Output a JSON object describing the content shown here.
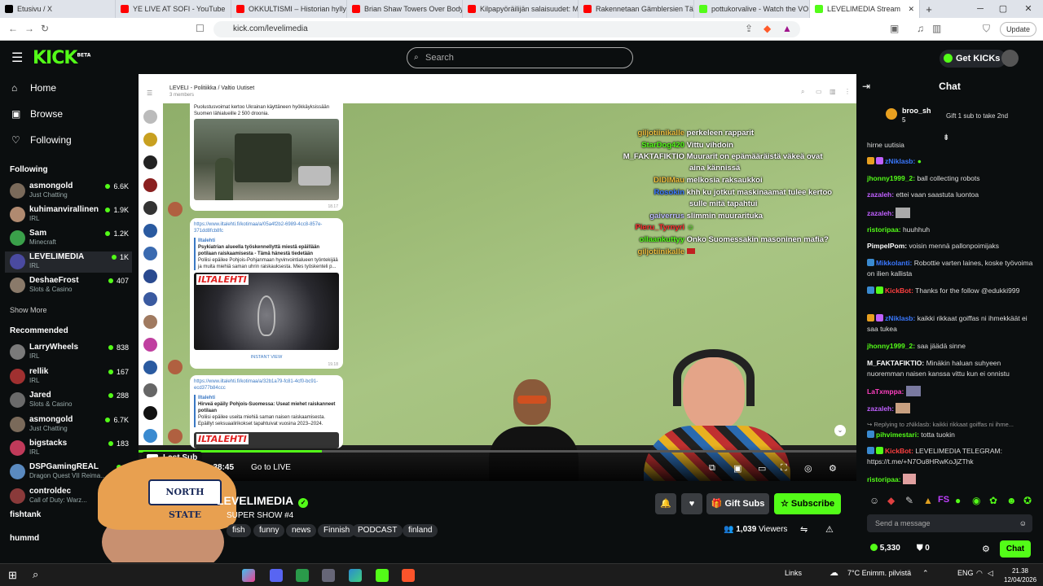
{
  "browser": {
    "tabs": [
      {
        "title": "Etusivu / X",
        "color": "#000000"
      },
      {
        "title": "YE LIVE AT SOFI - YouTube",
        "color": "#ff0000"
      },
      {
        "title": "OKKULTISMI – Historian hyllyt",
        "color": "#ff0000"
      },
      {
        "title": "Brian Shaw Towers Over Body",
        "color": "#ff0000"
      },
      {
        "title": "Kilpapyöräilijän salaisuudet: M",
        "color": "#ff0000"
      },
      {
        "title": "Rakennetaan Gämblersien Täy",
        "color": "#ff0000"
      },
      {
        "title": "pottukorvalive - Watch the VOD",
        "color": "#53fc18"
      },
      {
        "title": "LEVELIMEDIA Stream",
        "color": "#53fc18"
      }
    ],
    "url": "kick.com/levelimedia",
    "update_label": "Update"
  },
  "header": {
    "logo": "KICK",
    "logo_sup": "BETA",
    "search_placeholder": "Search",
    "get_kicks": "Get KICKs"
  },
  "sidebar": {
    "nav": [
      {
        "label": "Home",
        "icon": "home-icon"
      },
      {
        "label": "Browse",
        "icon": "browse-icon"
      },
      {
        "label": "Following",
        "icon": "heart-icon"
      }
    ],
    "following_title": "Following",
    "following": [
      {
        "name": "asmongold",
        "category": "Just Chatting",
        "viewers": "6.6K",
        "color": "#7a6a5a"
      },
      {
        "name": "kuhimanvirallinen",
        "category": "IRL",
        "viewers": "1.9K",
        "color": "#b08a70"
      },
      {
        "name": "Sam",
        "category": "Minecraft",
        "viewers": "1.2K",
        "color": "#3aa04a"
      },
      {
        "name": "LEVELIMEDIA",
        "category": "IRL",
        "viewers": "1K",
        "color": "#4a4aa0"
      },
      {
        "name": "DeshaeFrost",
        "category": "Slots & Casino",
        "viewers": "407",
        "color": "#8a7a6a"
      }
    ],
    "show_more": "Show More",
    "recommended_title": "Recommended",
    "recommended": [
      {
        "name": "LarryWheels",
        "category": "IRL",
        "viewers": "838",
        "color": "#7a7a7a"
      },
      {
        "name": "rellik",
        "category": "IRL",
        "viewers": "167",
        "color": "#a03030"
      },
      {
        "name": "Jared",
        "category": "Slots & Casino",
        "viewers": "288",
        "color": "#6a6a6a"
      },
      {
        "name": "asmongold",
        "category": "Just Chatting",
        "viewers": "6.7K",
        "color": "#7a6a5a"
      },
      {
        "name": "bigstacks",
        "category": "IRL",
        "viewers": "183",
        "color": "#c03a5a"
      },
      {
        "name": "DSPGamingREAL",
        "category": "Dragon Quest VII Reima...",
        "viewers": "7",
        "color": "#5a8ac0"
      },
      {
        "name": "controldec",
        "category": "Call of Duty: Warz...",
        "viewers": "",
        "color": "#8a3a3a"
      },
      {
        "name": "fishtank",
        "category": "",
        "viewers": "",
        "color": "#3a3a3a"
      },
      {
        "name": "hummd",
        "category": "",
        "viewers": "",
        "color": "#5a5a5a"
      }
    ]
  },
  "player": {
    "telegram_header": "LEVELI - Politiikka / Valtio Uutiset",
    "telegram_members": "3 members",
    "posts": [
      {
        "text": "Puolustusvoimat kertoo Ukrainan käyttäneen hyökkäyksissään Suomen lähialueille 2 500 droonia.",
        "time": "18.17"
      },
      {
        "link": "https://www.iltalehti.fi/kotimaa/a/05a4f2b2-6989-4cc8-857e-371dd8fcb8fc",
        "source": "Iltalehti",
        "headline": "Psykiatrian alueella työskennellyttä miestä epäillään potilaan raiskaamisesta - Tämä hänestä tiedetään",
        "body": "Poliisi epäilee Pohjois-Pohjanmaan hyvinvointialueen työntekijää ja muita miehiä saman uhrin raiskauksesta. Mies työskenteli p...",
        "image_label": "ILTALEHTI",
        "instant_view": "INSTANT VIEW",
        "time": "19.18"
      },
      {
        "link": "https://www.iltalehti.fi/kotimaa/a/32b1a79-fc81-4cf0-bc91-ecd377b84ccc",
        "source": "Iltalehti",
        "headline": "Hirveä epäily Pohjois-Suomessa: Useat miehet raiskanneet potilaan",
        "body": "Poliisi epäilee useita miehiä saman naisen raiskaamisesta. Epäillyt seksuaalirikokset tapahtuivat vuosina 2023–2024.",
        "image_label": "ILTALEHTI"
      }
    ],
    "overlay_chat": [
      {
        "user": "giljotiinikalle",
        "msg": "perkeleen rapparit",
        "color": "#f0c040"
      },
      {
        "user": "StarDog420",
        "msg": "Vittu vihdoin",
        "color": "#53fc18"
      },
      {
        "user": "M_FAKTAFIKTIO",
        "msg": "Muurarit on epämääräistä väkeä ovat",
        "msg2": "aina kännissä",
        "color": "#ffffff"
      },
      {
        "user": "DIDIMau",
        "msg": "melkosia raksaukkoi",
        "color": "#f0c040"
      },
      {
        "user": "Rosokin",
        "msg": "khh ku jotkut maskinaamat tulee kertoo",
        "msg2": "sulle mitä tapahtui",
        "color": "#3a78ff"
      },
      {
        "user": "gaiverrus",
        "msg": "slimmin muurarituka",
        "color": "#c0c0ff"
      },
      {
        "user": "Pieru_Tyrnyri",
        "msg": "",
        "color": "#ff3030"
      },
      {
        "user": "ollaankuttyy",
        "msg": "Onko Suomessakin masoninen mafia?",
        "color": "#53fc18"
      },
      {
        "user": "giljotiinikalle",
        "msg": "",
        "color": "#f0c040"
      }
    ],
    "last_sub": "Last Sub",
    "time": "00:38:45",
    "go_live": "Go to LIVE",
    "progress": 0.255
  },
  "info": {
    "channel_name": "LEVELIMEDIA",
    "stream_title": "SUPER SHOW #4",
    "tags": [
      "fish",
      "funny",
      "news",
      "Finnish",
      "PODCAST",
      "finland"
    ],
    "gift_subs": "Gift Subs",
    "subscribe": "Subscribe",
    "viewers_count": "1,039",
    "viewers_label": "Viewers"
  },
  "chat": {
    "title": "Chat",
    "gift_user": "broo_sh",
    "gift_count": "5",
    "gift_text": "Gift 1 sub to take 2nd",
    "messages": [
      {
        "user": "",
        "text": "hirne uutisia",
        "color": "#ddd"
      },
      {
        "user": "zNiklasb:",
        "text": "",
        "color": "#3a78ff"
      },
      {
        "user": "jhonny1999_2:",
        "text": "ball collecting robots",
        "color": "#53fc18"
      },
      {
        "user": "zazaleh:",
        "text": "ettei vaan saastuta luontoa",
        "color": "#c060ff"
      },
      {
        "user": "zazaleh:",
        "text": "",
        "color": "#c060ff"
      },
      {
        "user": "ristoripaa:",
        "text": "huuhhuh",
        "color": "#53fc18"
      },
      {
        "user": "PimpelPom:",
        "text": "voisin mennä pallonpoimijaks",
        "color": "#ffffff"
      },
      {
        "user": "Mikkolanti:",
        "text": "Robottie varten laines, koske työvoima on ilien kallista",
        "color": "#3a78ff"
      },
      {
        "user": "KickBot:",
        "text": "Thanks for the follow @edukki999",
        "color": "#ff4040"
      },
      {
        "user": "zNiklasb:",
        "text": "kaikki rikkaat goiffas ni ihmekkäät ei saa tukea",
        "color": "#3a78ff"
      },
      {
        "user": "jhonny1999_2:",
        "text": "saa jäädä sinne",
        "color": "#53fc18"
      },
      {
        "user": "M_FAKTAFIKTIO:",
        "text": "Minäkin haluan suhyeen nuoremman naisen kanssa vittu kun ei onnistu",
        "color": "#ffffff"
      },
      {
        "user": "LaTxmppa:",
        "text": "",
        "color": "#ff40c0"
      },
      {
        "user": "zazaleh:",
        "text": "",
        "color": "#c060ff"
      },
      {
        "user": "",
        "text": "Replying to zNiklasb: kaikki rikkaat goiffas ni ihme...",
        "color": "#999"
      },
      {
        "user": "pihvimestari:",
        "text": "totta tuokin",
        "color": "#53fc18"
      },
      {
        "user": "KickBot:",
        "text": "LEVELIMEDIA TELEGRAM: https://t.me/+N7Ou8HRwKoJjZThk",
        "color": "#ff4040"
      },
      {
        "user": "ristoripaa:",
        "text": "",
        "color": "#53fc18"
      }
    ],
    "input_placeholder": "Send a message",
    "kicks_balance": "5,330",
    "points": "0",
    "send_label": "Chat"
  },
  "taskbar": {
    "links_label": "Links",
    "weather": "7°C  Enimm. pilvistä",
    "lang": "ENG",
    "clock_time": "21.38",
    "clock_date": "12/04/2026"
  }
}
